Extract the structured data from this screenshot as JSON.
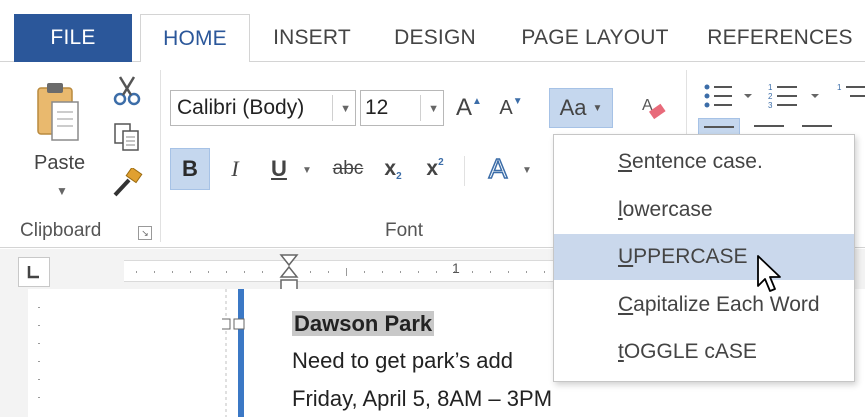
{
  "tabs": {
    "file": "FILE",
    "home": "HOME",
    "insert": "INSERT",
    "design": "DESIGN",
    "page_layout": "PAGE LAYOUT",
    "references": "REFERENCES"
  },
  "clipboard": {
    "paste_label": "Paste",
    "group_label": "Clipboard"
  },
  "font": {
    "family": "Calibri (Body)",
    "size": "12",
    "group_label": "Font",
    "grow_label": "A",
    "shrink_label": "A",
    "change_case_label": "Aa",
    "bold": "B",
    "italic": "I",
    "underline": "U",
    "strikethrough": "abc",
    "subscript": "x",
    "subscript_mark": "2",
    "superscript": "x",
    "superscript_mark": "2",
    "text_effects": "A"
  },
  "change_case_menu": {
    "items": [
      {
        "label": "Sentence case.",
        "highlighted": false
      },
      {
        "label": "lowercase",
        "highlighted": false
      },
      {
        "label": "UPPERCASE",
        "highlighted": true
      },
      {
        "label": "Capitalize Each Word",
        "highlighted": false
      },
      {
        "label": "tOGGLE cASE",
        "highlighted": false
      }
    ]
  },
  "ruler": {
    "mark_1": "1"
  },
  "document": {
    "line1": "Dawson Park",
    "line2": "Need to get park’s add",
    "line3": "Friday,  April 5, 8AM – 3PM"
  },
  "colors": {
    "file_tab": "#2b579a",
    "accent": "#2b579a",
    "menu_highlight": "#cad8ec",
    "selection": "#c8c8c8"
  }
}
